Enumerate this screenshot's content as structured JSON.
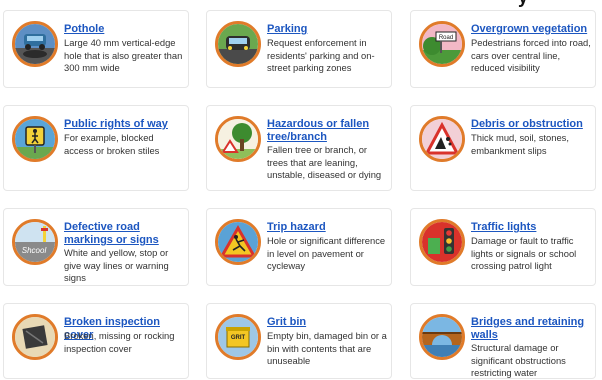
{
  "top_text": "y",
  "cards": [
    {
      "title": "Pothole",
      "desc": "Large 40 mm vertical-edge hole that is also greater than 300 mm wide",
      "icon": "pothole-icon"
    },
    {
      "title": "Parking",
      "desc": "Request enforcement in residents' parking and on-street parking zones",
      "icon": "car-icon"
    },
    {
      "title": "Overgrown vegetation",
      "desc": "Pedestrians forced into road, cars over central line, reduced visibility",
      "icon": "vegetation-icon",
      "sign_text": "Road"
    },
    {
      "title": "Public rights of way",
      "desc": "For example, blocked access or broken stiles",
      "icon": "pedestrian-sign-icon"
    },
    {
      "title": "Hazardous or fallen tree/branch",
      "desc": "Fallen tree or branch, or trees that are leaning, unstable, diseased or dying",
      "icon": "tree-icon"
    },
    {
      "title": "Debris or obstruction",
      "desc": "Thick mud, soil, stones, embankment slips",
      "icon": "falling-rocks-icon"
    },
    {
      "title": "Defective road markings or signs",
      "desc": "White and yellow, stop or give way lines or warning signs",
      "icon": "school-road-marking-icon",
      "marking_text": "Shcool"
    },
    {
      "title": "Trip hazard",
      "desc": "Hole or significant difference in level on pavement or cycleway",
      "icon": "trip-hazard-icon"
    },
    {
      "title": "Traffic lights",
      "desc": "Damage or fault to traffic lights or signals or school crossing patrol light",
      "icon": "traffic-light-icon"
    },
    {
      "title": "Broken inspection cover",
      "desc": "Broken, missing or rocking inspection cover",
      "icon": "inspection-cover-icon"
    },
    {
      "title": "Grit bin",
      "desc": "Empty bin, damaged bin or a bin with contents that are unuseable",
      "icon": "grit-bin-icon",
      "bin_text": "GRIT"
    },
    {
      "title": "Bridges and retaining walls",
      "desc": "Structural damage or significant obstructions restricting water",
      "icon": "bridge-icon"
    }
  ]
}
